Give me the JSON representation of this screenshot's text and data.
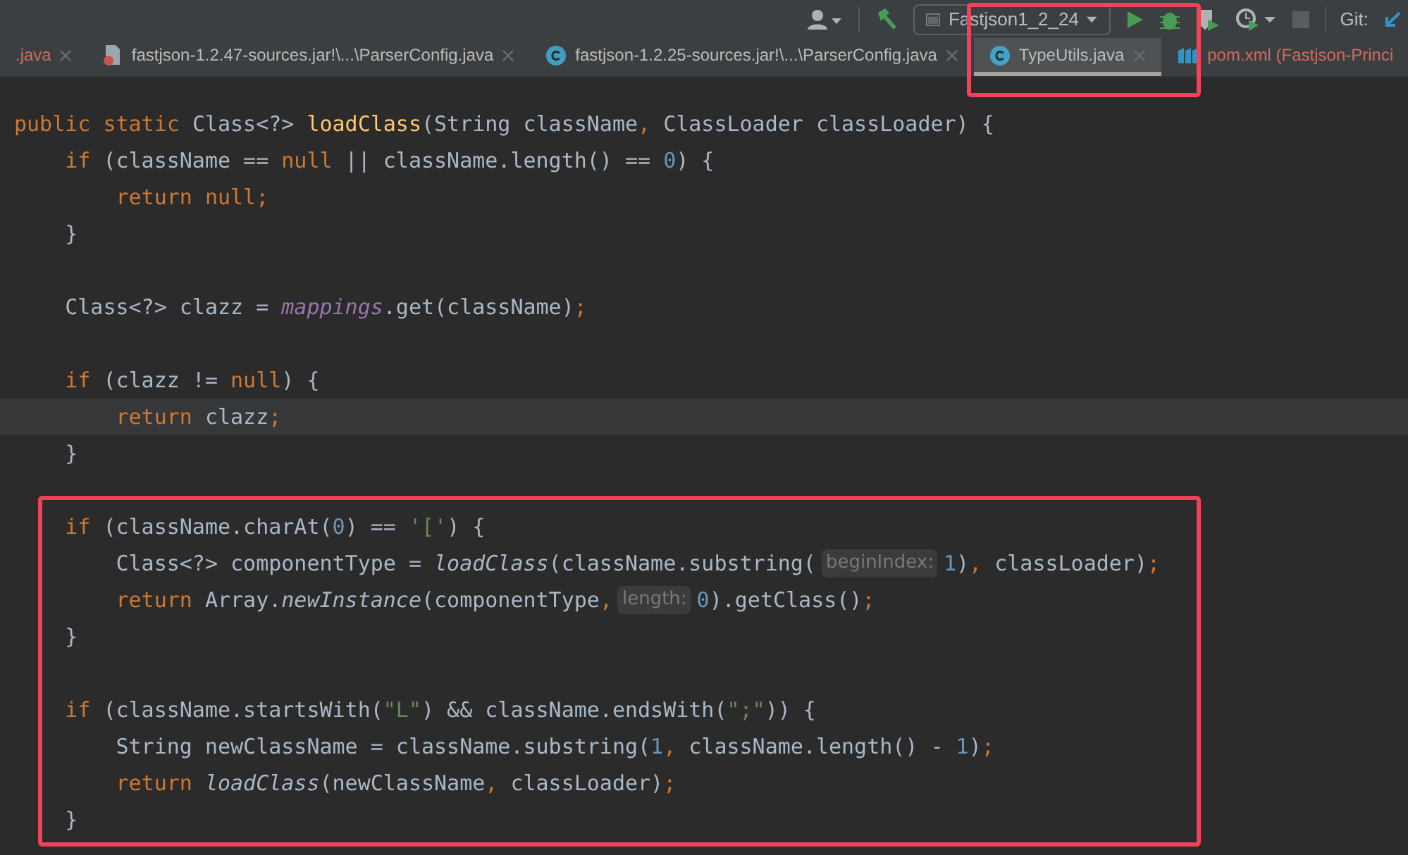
{
  "toolbar": {
    "run_config": "Fastjson1_2_24",
    "git_label": "Git:"
  },
  "tabs": [
    {
      "label": ".java",
      "selected": false,
      "kind": "plain",
      "color": "#d2695e"
    },
    {
      "label": "fastjson-1.2.47-sources.jar!\\...\\ParserConfig.java",
      "selected": false,
      "kind": "jar",
      "color": "#bbbbbb"
    },
    {
      "label": "fastjson-1.2.25-sources.jar!\\...\\ParserConfig.java",
      "selected": false,
      "kind": "class",
      "color": "#bbbbbb"
    },
    {
      "label": "TypeUtils.java",
      "selected": true,
      "kind": "class",
      "color": "#bbbbbb"
    },
    {
      "label": "pom.xml (Fastjson-Princi",
      "selected": false,
      "kind": "maven",
      "color": "#d2695e"
    }
  ],
  "code": [
    {
      "current": false,
      "tokens": [
        {
          "kind": "kw",
          "text": "public static "
        },
        {
          "kind": "plain",
          "text": "Class<?> "
        },
        {
          "kind": "fn",
          "text": "loadClass"
        },
        {
          "kind": "plain",
          "text": "(String className"
        },
        {
          "kind": "kw",
          "text": ","
        },
        {
          "kind": "plain",
          "text": " ClassLoader classLoader) {"
        }
      ]
    },
    {
      "current": false,
      "tokens": [
        {
          "kind": "kw",
          "text": "    if"
        },
        {
          "kind": "plain",
          "text": " (className == "
        },
        {
          "kind": "kw",
          "text": "null"
        },
        {
          "kind": "plain",
          "text": " || className.length() == "
        },
        {
          "kind": "num",
          "text": "0"
        },
        {
          "kind": "plain",
          "text": ") {"
        }
      ]
    },
    {
      "current": false,
      "tokens": [
        {
          "kind": "kw",
          "text": "        return null;"
        }
      ]
    },
    {
      "current": false,
      "tokens": [
        {
          "kind": "plain",
          "text": "    }"
        }
      ]
    },
    {
      "current": false
    },
    {
      "current": false,
      "tokens": [
        {
          "kind": "plain",
          "text": "    Class<?> clazz = "
        },
        {
          "kind": "field",
          "text": "mappings"
        },
        {
          "kind": "plain",
          "text": ".get(className)"
        },
        {
          "kind": "kw",
          "text": ";"
        }
      ]
    },
    {
      "current": false
    },
    {
      "current": false,
      "tokens": [
        {
          "kind": "kw",
          "text": "    if"
        },
        {
          "kind": "plain",
          "text": " (clazz != "
        },
        {
          "kind": "kw",
          "text": "null"
        },
        {
          "kind": "plain",
          "text": ") {"
        }
      ]
    },
    {
      "current": true,
      "tokens": [
        {
          "kind": "kw",
          "text": "        return"
        },
        {
          "kind": "plain",
          "text": " clazz"
        },
        {
          "kind": "kw",
          "text": ";"
        }
      ]
    },
    {
      "current": false,
      "tokens": [
        {
          "kind": "plain",
          "text": "    }"
        }
      ]
    },
    {
      "current": false
    },
    {
      "current": false,
      "tokens": [
        {
          "kind": "kw",
          "text": "    if"
        },
        {
          "kind": "plain",
          "text": " (className.charAt("
        },
        {
          "kind": "num",
          "text": "0"
        },
        {
          "kind": "plain",
          "text": ") == "
        },
        {
          "kind": "str",
          "text": "'['"
        },
        {
          "kind": "plain",
          "text": ") {"
        }
      ]
    },
    {
      "current": false,
      "tokens": [
        {
          "kind": "plain",
          "text": "        Class<?> componentType = "
        },
        {
          "kind": "italic",
          "text": "loadClass"
        },
        {
          "kind": "plain",
          "text": "(className.substring("
        },
        {
          "kind": "hint",
          "text": "beginIndex:"
        },
        {
          "kind": "num",
          "text": "1"
        },
        {
          "kind": "plain",
          "text": ")"
        },
        {
          "kind": "kw",
          "text": ","
        },
        {
          "kind": "plain",
          "text": " classLoader)"
        },
        {
          "kind": "kw",
          "text": ";"
        }
      ]
    },
    {
      "current": false,
      "tokens": [
        {
          "kind": "kw",
          "text": "        return"
        },
        {
          "kind": "plain",
          "text": " Array."
        },
        {
          "kind": "italic",
          "text": "newInstance"
        },
        {
          "kind": "plain",
          "text": "(componentType"
        },
        {
          "kind": "kw",
          "text": ","
        },
        {
          "kind": "hint",
          "text": "length:"
        },
        {
          "kind": "num",
          "text": "0"
        },
        {
          "kind": "plain",
          "text": ").getClass()"
        },
        {
          "kind": "kw",
          "text": ";"
        }
      ]
    },
    {
      "current": false,
      "tokens": [
        {
          "kind": "plain",
          "text": "    }"
        }
      ]
    },
    {
      "current": false
    },
    {
      "current": false,
      "tokens": [
        {
          "kind": "kw",
          "text": "    if"
        },
        {
          "kind": "plain",
          "text": " (className.startsWith("
        },
        {
          "kind": "str",
          "text": "\"L\""
        },
        {
          "kind": "plain",
          "text": ") && className.endsWith("
        },
        {
          "kind": "str",
          "text": "\";\""
        },
        {
          "kind": "plain",
          "text": ")) {"
        }
      ]
    },
    {
      "current": false,
      "tokens": [
        {
          "kind": "plain",
          "text": "        String newClassName = className.substring("
        },
        {
          "kind": "num",
          "text": "1"
        },
        {
          "kind": "kw",
          "text": ","
        },
        {
          "kind": "plain",
          "text": " className.length() - "
        },
        {
          "kind": "num",
          "text": "1"
        },
        {
          "kind": "plain",
          "text": ")"
        },
        {
          "kind": "kw",
          "text": ";"
        }
      ]
    },
    {
      "current": false,
      "tokens": [
        {
          "kind": "kw",
          "text": "        return "
        },
        {
          "kind": "italic",
          "text": "loadClass"
        },
        {
          "kind": "plain",
          "text": "(newClassName"
        },
        {
          "kind": "kw",
          "text": ","
        },
        {
          "kind": "plain",
          "text": " classLoader)"
        },
        {
          "kind": "kw",
          "text": ";"
        }
      ]
    },
    {
      "current": false,
      "tokens": [
        {
          "kind": "plain",
          "text": "    }"
        }
      ]
    }
  ]
}
